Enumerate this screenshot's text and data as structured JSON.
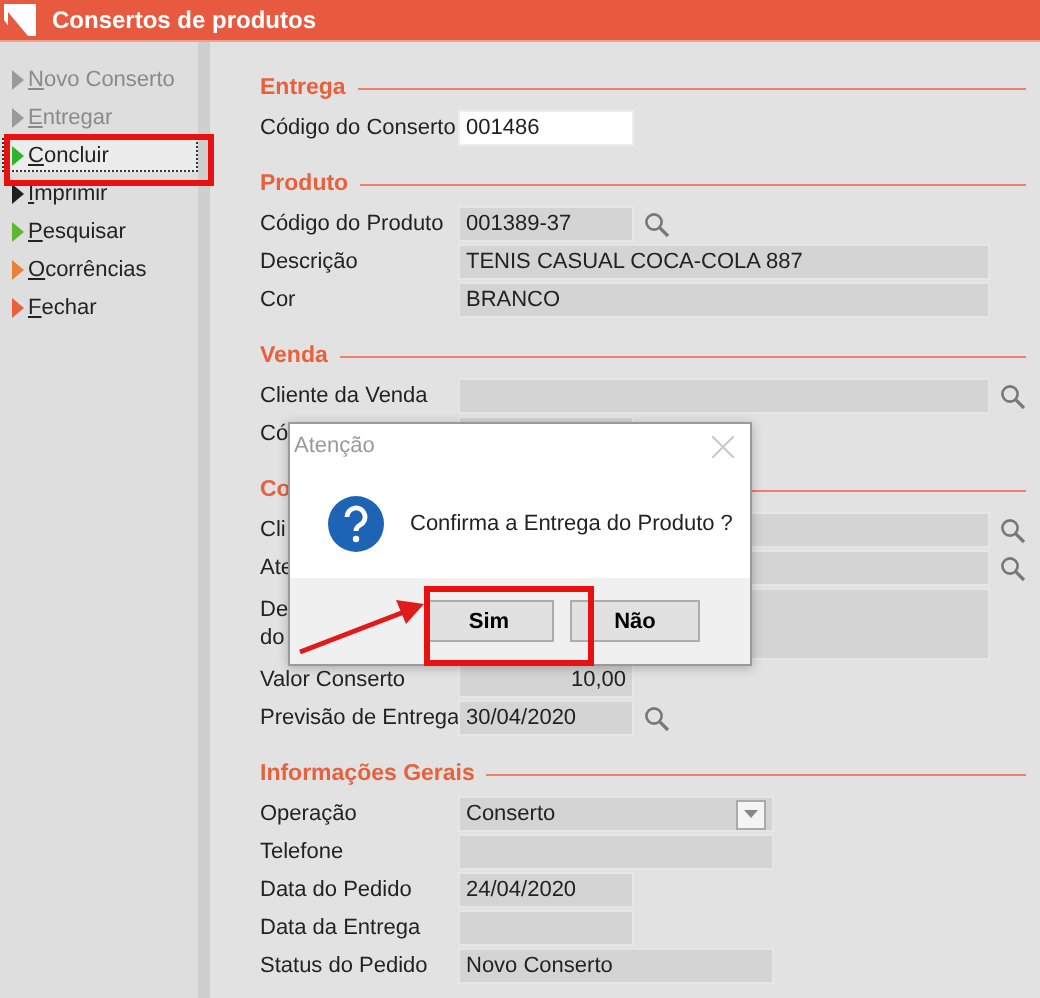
{
  "window": {
    "title": "Consertos de produtos"
  },
  "sidebar": {
    "items": [
      {
        "label": "Novo Conserto",
        "color": "#9a9a9a",
        "disabled": true,
        "focused": false
      },
      {
        "label": "Entregar",
        "color": "#9a9a9a",
        "disabled": true,
        "focused": false
      },
      {
        "label": "Concluir",
        "color": "#2db52d",
        "disabled": false,
        "focused": true
      },
      {
        "label": "Imprimir",
        "color": "#202020",
        "disabled": false,
        "focused": false
      },
      {
        "label": "Pesquisar",
        "color": "#5cb82e",
        "disabled": false,
        "focused": false
      },
      {
        "label": "Ocorrências",
        "color": "#e8813a",
        "disabled": false,
        "focused": false
      },
      {
        "label": "Fechar",
        "color": "#e8603c",
        "disabled": false,
        "focused": false
      }
    ]
  },
  "sections": [
    {
      "title": "Entrega",
      "fields": [
        {
          "label": "Código do Conserto",
          "value": "001486",
          "kind": "short",
          "readonly": false,
          "lookup": false
        }
      ]
    },
    {
      "title": "Produto",
      "fields": [
        {
          "label": "Código do Produto",
          "value": "001389-37",
          "kind": "short",
          "readonly": true,
          "lookup": true
        },
        {
          "label": "Descrição",
          "value": "TENIS CASUAL COCA-COLA 887",
          "kind": "long",
          "readonly": true,
          "lookup": false
        },
        {
          "label": "Cor",
          "value": "BRANCO",
          "kind": "long",
          "readonly": true,
          "lookup": false
        }
      ]
    },
    {
      "title": "Venda",
      "fields": [
        {
          "label": "Cliente da Venda",
          "kind": "long",
          "readonly": true,
          "lookup": true
        },
        {
          "label": "Có",
          "kind": "short",
          "lookup": false
        }
      ]
    },
    {
      "title": "Co",
      "fields": [
        {
          "label": "Cli",
          "kind": "long",
          "readonly": true,
          "lookup": true
        },
        {
          "label": "Ate",
          "kind": "long",
          "readonly": true,
          "lookup": true
        },
        {
          "label": "De\ndo",
          "kind": "memo",
          "readonly": true,
          "lookup": false
        },
        {
          "label": "Valor Conserto",
          "value": "10,00",
          "kind": "number",
          "readonly": true,
          "lookup": false
        },
        {
          "label": "Previsão de Entrega",
          "value": "30/04/2020",
          "kind": "short",
          "readonly": true,
          "lookup": true
        }
      ]
    },
    {
      "title": "Informações Gerais",
      "fields": [
        {
          "label": "Operação",
          "value": "Conserto",
          "kind": "dropdown",
          "readonly": true,
          "lookup": false
        },
        {
          "label": "Telefone",
          "kind": "medium",
          "readonly": true,
          "lookup": false
        },
        {
          "label": "Data do Pedido",
          "value": "24/04/2020",
          "kind": "short",
          "readonly": true,
          "lookup": false
        },
        {
          "label": "Data da Entrega",
          "kind": "short",
          "readonly": true,
          "lookup": false
        },
        {
          "label": "Status do Pedido",
          "value": "Novo Conserto",
          "kind": "medium",
          "readonly": true,
          "lookup": false
        }
      ]
    }
  ],
  "dialog": {
    "title": "Atenção",
    "message": "Confirma a Entrega do Produto ?",
    "buttons": [
      {
        "label": "Sim"
      },
      {
        "label": "Não"
      }
    ]
  }
}
